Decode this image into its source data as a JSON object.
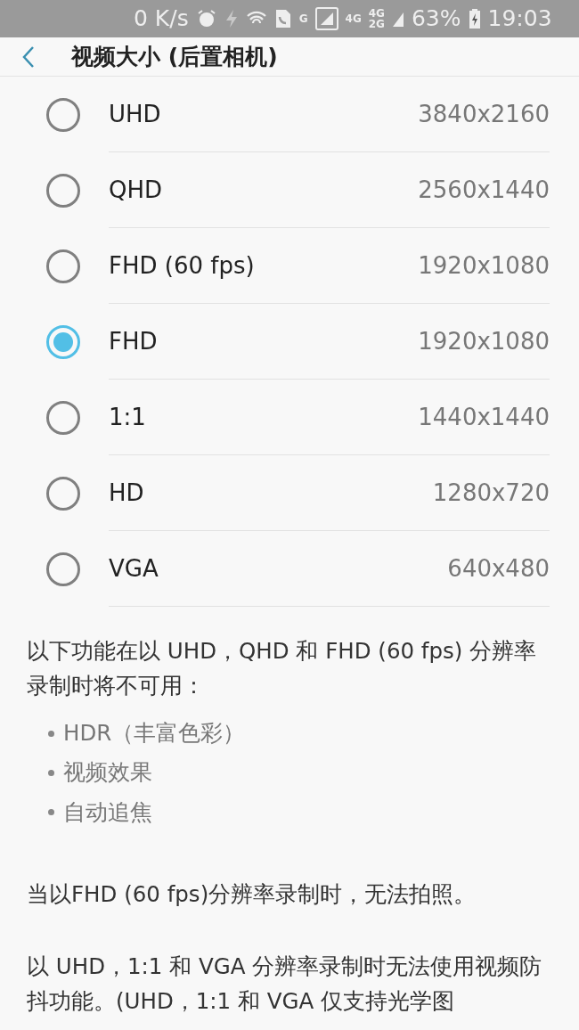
{
  "status_bar": {
    "speed": "0 K/s",
    "network_1": "G",
    "network_2": "4G",
    "network_3": "4G",
    "network_4": "2G",
    "battery": "63%",
    "time": "19:03"
  },
  "header": {
    "title": "视频大小 (后置相机)"
  },
  "options": [
    {
      "label": "UHD",
      "resolution": "3840x2160",
      "selected": false
    },
    {
      "label": "QHD",
      "resolution": "2560x1440",
      "selected": false
    },
    {
      "label": "FHD (60 fps)",
      "resolution": "1920x1080",
      "selected": false
    },
    {
      "label": "FHD",
      "resolution": "1920x1080",
      "selected": true
    },
    {
      "label": "1:1",
      "resolution": "1440x1440",
      "selected": false
    },
    {
      "label": "HD",
      "resolution": "1280x720",
      "selected": false
    },
    {
      "label": "VGA",
      "resolution": "640x480",
      "selected": false
    }
  ],
  "notes": [
    {
      "kind": "paragraph",
      "text": "以下功能在以 UHD，QHD 和 FHD (60 fps) 分辨率录制时将不可用："
    },
    {
      "kind": "bullets",
      "items": [
        "HDR（丰富色彩）",
        "视频效果",
        "自动追焦"
      ]
    },
    {
      "kind": "paragraph",
      "text": "当以FHD (60 fps)分辨率录制时，无法拍照。"
    },
    {
      "kind": "paragraph",
      "text": "以 UHD，1:1 和 VGA 分辨率录制时无法使用视频防抖功能。(UHD，1:1 和 VGA 仅支持光学图"
    }
  ]
}
